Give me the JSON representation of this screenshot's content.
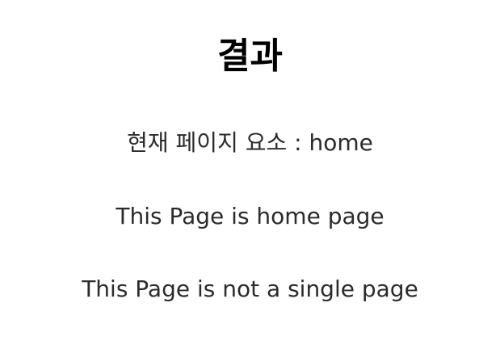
{
  "page": {
    "title": "결과",
    "current_element": "현재 페이지 요소 : home",
    "home_status": "This Page is home page",
    "single_status": "This Page is not a single page"
  }
}
